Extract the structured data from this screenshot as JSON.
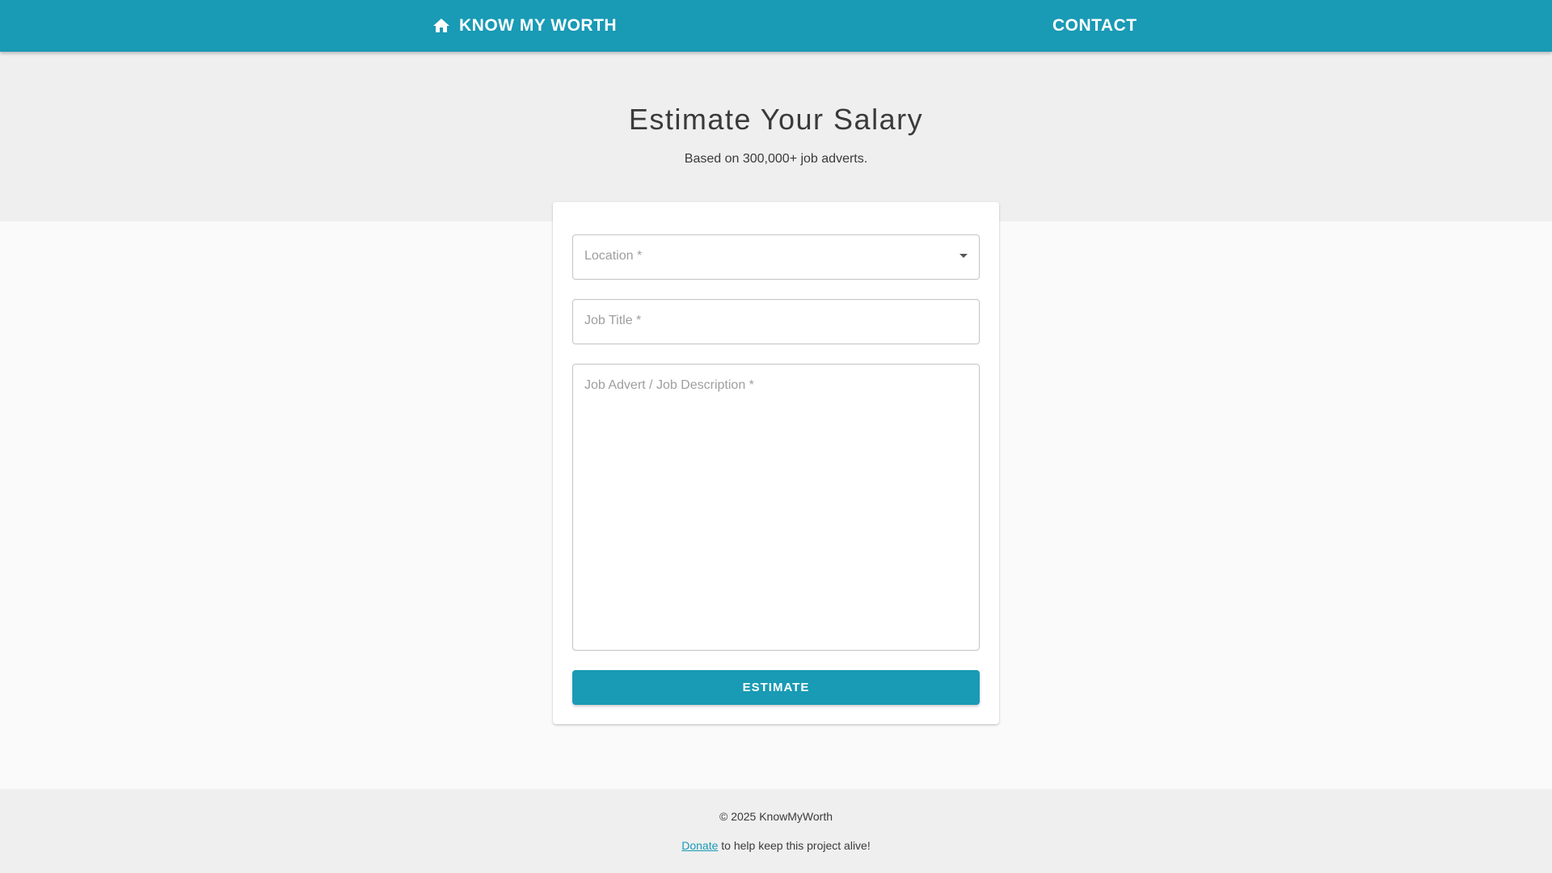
{
  "header": {
    "brand_label": "KNOW MY WORTH",
    "brand_icon": "home-icon",
    "contact_label": "CONTACT"
  },
  "hero": {
    "title": "Estimate Your Salary",
    "subtitle": "Based on 300,000+ job adverts."
  },
  "form": {
    "location_label": "Location *",
    "location_value": "",
    "job_title_label": "Job Title *",
    "job_title_value": "",
    "description_label": "Job Advert / Job Description *",
    "description_value": "",
    "estimate_label": "ESTIMATE"
  },
  "footer": {
    "copyright": "© 2025 KnowMyWorth",
    "donate_link": "Donate",
    "donate_rest": " to help keep this project alive!"
  },
  "colors": {
    "primary": "#199ab5",
    "hero_bg": "#efefef",
    "page_bg": "#fafafa"
  }
}
